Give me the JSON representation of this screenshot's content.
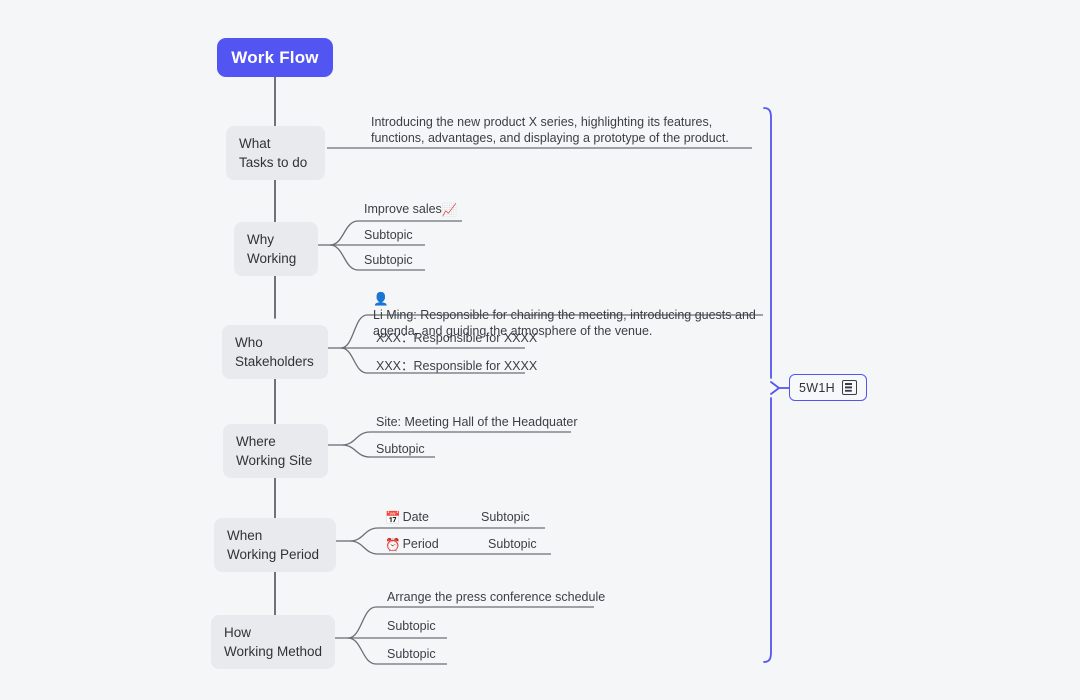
{
  "canvas": {
    "background": "#f5f6f8",
    "accent": "#5355f3",
    "node_fill": "#e9eaed",
    "line_color": "#5b5f66"
  },
  "root": {
    "label": "Work Flow"
  },
  "summary": {
    "label": "5W1H",
    "icon": "note-icon"
  },
  "branches": [
    {
      "title_line1": "What",
      "title_line2": "Tasks to do",
      "subtopics": [
        {
          "text": "Introducing the new product X series, highlighting its features, functions, advantages, and displaying a prototype of the product.",
          "emoji": "",
          "child": ""
        }
      ]
    },
    {
      "title_line1": "Why",
      "title_line2": "Working",
      "subtopics": [
        {
          "text": "Improve sales",
          "emoji": "📈",
          "emoji_after": true,
          "child": ""
        },
        {
          "text": "Subtopic",
          "emoji": "",
          "child": ""
        },
        {
          "text": "Subtopic",
          "emoji": "",
          "child": ""
        }
      ]
    },
    {
      "title_line1": "Who",
      "title_line2": "Stakeholders",
      "subtopics": [
        {
          "text": "Li Ming: Responsible for chairing the meeting, introducing guests and agenda, and guiding the atmosphere of the venue.",
          "emoji": "👤",
          "child": ""
        },
        {
          "text": "XXX：Responsible for XXXX",
          "emoji": "",
          "child": ""
        },
        {
          "text": "XXX：Responsible for XXXX",
          "emoji": "",
          "child": ""
        }
      ]
    },
    {
      "title_line1": "Where",
      "title_line2": "Working Site",
      "subtopics": [
        {
          "text": "Site: Meeting Hall of the Headquater",
          "emoji": "",
          "child": ""
        },
        {
          "text": "Subtopic",
          "emoji": "",
          "child": ""
        }
      ]
    },
    {
      "title_line1": "When",
      "title_line2": "Working Period",
      "subtopics": [
        {
          "text": "Date",
          "emoji": "📅",
          "child": "Subtopic"
        },
        {
          "text": "Period",
          "emoji": "⏰",
          "child": "Subtopic"
        }
      ]
    },
    {
      "title_line1": "How",
      "title_line2": "Working Method",
      "subtopics": [
        {
          "text": "Arrange the press conference schedule",
          "emoji": "",
          "child": ""
        },
        {
          "text": "Subtopic",
          "emoji": "",
          "child": ""
        },
        {
          "text": "Subtopic",
          "emoji": "",
          "child": ""
        }
      ]
    }
  ]
}
